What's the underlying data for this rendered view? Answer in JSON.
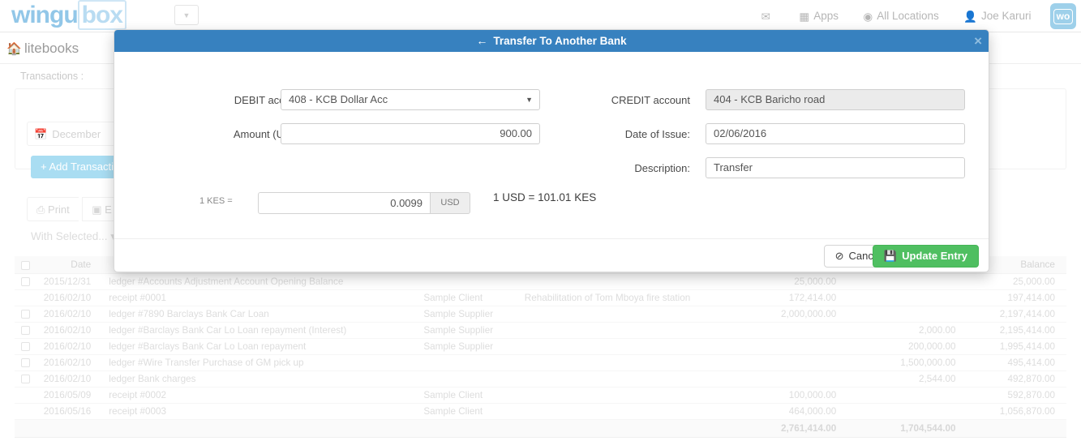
{
  "topnav": {
    "logo_part1": "wingu",
    "logo_part2": "box",
    "caret_icon": "chevron-down-icon",
    "items": [
      {
        "icon": "envelope-icon",
        "glyph": "✉",
        "label": ""
      },
      {
        "icon": "apps-grid-icon",
        "glyph": "☷",
        "label": "Apps"
      },
      {
        "icon": "globe-icon",
        "glyph": "◎",
        "label": "All Locations"
      },
      {
        "icon": "user-icon",
        "glyph": "●",
        "label": "Joe Karuri"
      }
    ],
    "badge_label": "wo"
  },
  "breadcrumb": {
    "home_icon": "home-icon",
    "label": "litebooks"
  },
  "page": {
    "title": "Transactions :",
    "date_filter": {
      "icon": "calendar-icon",
      "value": "December"
    },
    "add_transaction_label": "+  Add Transaction",
    "toolbar": [
      {
        "icon": "printer-icon",
        "glyph": "⎙",
        "label": "Print"
      },
      {
        "icon": "excel-icon",
        "glyph": "x",
        "label": "E"
      }
    ],
    "with_selected_label": "With Selected...",
    "table": {
      "headers": {
        "check": "",
        "date": "Date",
        "description": "",
        "party": "",
        "memo": "",
        "debit": "",
        "credit": "",
        "balance": "Balance"
      },
      "rows": [
        {
          "checkbox": true,
          "date": "2015/12/31",
          "description": "ledger #Accounts Adjustment Account Opening Balance",
          "party": "",
          "memo": "",
          "debit": "25,000.00",
          "credit": "",
          "balance": "25,000.00"
        },
        {
          "checkbox": false,
          "date": "2016/02/10",
          "description": "receipt #0001",
          "party": "Sample Client",
          "memo": "Rehabilitation of Tom Mboya fire station",
          "debit": "172,414.00",
          "credit": "",
          "balance": "197,414.00"
        },
        {
          "checkbox": true,
          "date": "2016/02/10",
          "description": "ledger #7890 Barclays Bank Car Loan",
          "party": "Sample Supplier",
          "memo": "",
          "debit": "2,000,000.00",
          "credit": "",
          "balance": "2,197,414.00"
        },
        {
          "checkbox": true,
          "date": "2016/02/10",
          "description": "ledger #Barclays Bank Car Lo Loan repayment (Interest)",
          "party": "Sample Supplier",
          "memo": "",
          "debit": "",
          "credit": "2,000.00",
          "balance": "2,195,414.00"
        },
        {
          "checkbox": true,
          "date": "2016/02/10",
          "description": "ledger #Barclays Bank Car Lo Loan repayment",
          "party": "Sample Supplier",
          "memo": "",
          "debit": "",
          "credit": "200,000.00",
          "balance": "1,995,414.00"
        },
        {
          "checkbox": true,
          "date": "2016/02/10",
          "description": "ledger #Wire Transfer Purchase of GM pick up",
          "party": "",
          "memo": "",
          "debit": "",
          "credit": "1,500,000.00",
          "balance": "495,414.00"
        },
        {
          "checkbox": true,
          "date": "2016/02/10",
          "description": "ledger Bank charges",
          "party": "",
          "memo": "",
          "debit": "",
          "credit": "2,544.00",
          "balance": "492,870.00"
        },
        {
          "checkbox": false,
          "date": "2016/05/09",
          "description": "receipt #0002",
          "party": "Sample Client",
          "memo": "",
          "debit": "100,000.00",
          "credit": "",
          "balance": "592,870.00"
        },
        {
          "checkbox": false,
          "date": "2016/05/16",
          "description": "receipt #0003",
          "party": "Sample Client",
          "memo": "",
          "debit": "464,000.00",
          "credit": "",
          "balance": "1,056,870.00"
        }
      ],
      "totals": {
        "debit": "2,761,414.00",
        "credit": "1,704,544.00",
        "balance": ""
      }
    }
  },
  "modal": {
    "back_icon": "arrow-left-icon",
    "title": "Transfer To Another Bank",
    "close_icon": "close-icon",
    "close_glyph": "×",
    "fields": {
      "debit_account": {
        "label": "DEBIT account",
        "value": "408 - KCB Dollar Acc",
        "caret": "▼"
      },
      "amount": {
        "label": "Amount (USD):",
        "value": "900.00"
      },
      "credit_account": {
        "label": "CREDIT account",
        "value": "404 - KCB Baricho road"
      },
      "date_of_issue": {
        "label": "Date of Issue:",
        "value": "02/06/2016"
      },
      "description": {
        "label": "Description:",
        "value": "Transfer"
      }
    },
    "rate": {
      "prefix_label": "1 KES =",
      "value": "0.0099",
      "addon": "USD",
      "note": "1 USD = 101.01 KES"
    },
    "footer": {
      "cancel": {
        "label": "Cancel",
        "icon": "ban-icon",
        "glyph": "⊘"
      },
      "update": {
        "label": "Update Entry",
        "icon": "save-disk-icon",
        "glyph": "ὋE"
      }
    }
  },
  "colors": {
    "modal_header": "#3781bf",
    "primary_button": "#4fbf61",
    "logo": "#92c7e8",
    "add_button": "#a9ddf2"
  }
}
